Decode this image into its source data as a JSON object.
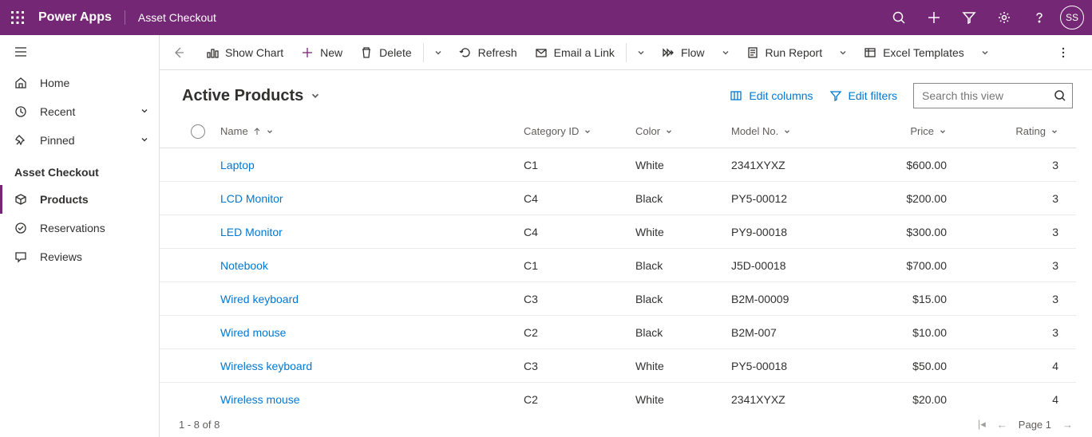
{
  "header": {
    "brand": "Power Apps",
    "subtitle": "Asset Checkout",
    "avatar": "SS"
  },
  "sidebar": {
    "home": "Home",
    "recent": "Recent",
    "pinned": "Pinned",
    "group": "Asset Checkout",
    "items": [
      {
        "label": "Products"
      },
      {
        "label": "Reservations"
      },
      {
        "label": "Reviews"
      }
    ]
  },
  "cmdbar": {
    "show_chart": "Show Chart",
    "new": "New",
    "delete": "Delete",
    "refresh": "Refresh",
    "email": "Email a Link",
    "flow": "Flow",
    "run_report": "Run Report",
    "excel": "Excel Templates"
  },
  "view": {
    "title": "Active Products",
    "edit_columns": "Edit columns",
    "edit_filters": "Edit filters",
    "search_placeholder": "Search this view"
  },
  "columns": {
    "name": "Name",
    "category": "Category ID",
    "color": "Color",
    "model": "Model No.",
    "price": "Price",
    "rating": "Rating"
  },
  "rows": [
    {
      "name": "Laptop",
      "cat": "C1",
      "color": "White",
      "model": "2341XYXZ",
      "price": "$600.00",
      "rating": "3"
    },
    {
      "name": "LCD Monitor",
      "cat": "C4",
      "color": "Black",
      "model": "PY5-00012",
      "price": "$200.00",
      "rating": "3"
    },
    {
      "name": "LED Monitor",
      "cat": "C4",
      "color": "White",
      "model": "PY9-00018",
      "price": "$300.00",
      "rating": "3"
    },
    {
      "name": "Notebook",
      "cat": "C1",
      "color": "Black",
      "model": "J5D-00018",
      "price": "$700.00",
      "rating": "3"
    },
    {
      "name": "Wired keyboard",
      "cat": "C3",
      "color": "Black",
      "model": "B2M-00009",
      "price": "$15.00",
      "rating": "3"
    },
    {
      "name": "Wired mouse",
      "cat": "C2",
      "color": "Black",
      "model": "B2M-007",
      "price": "$10.00",
      "rating": "3"
    },
    {
      "name": "Wireless keyboard",
      "cat": "C3",
      "color": "White",
      "model": "PY5-00018",
      "price": "$50.00",
      "rating": "4"
    },
    {
      "name": "Wireless mouse",
      "cat": "C2",
      "color": "White",
      "model": "2341XYXZ",
      "price": "$20.00",
      "rating": "4"
    }
  ],
  "footer": {
    "count": "1 - 8 of 8",
    "page": "Page 1"
  }
}
